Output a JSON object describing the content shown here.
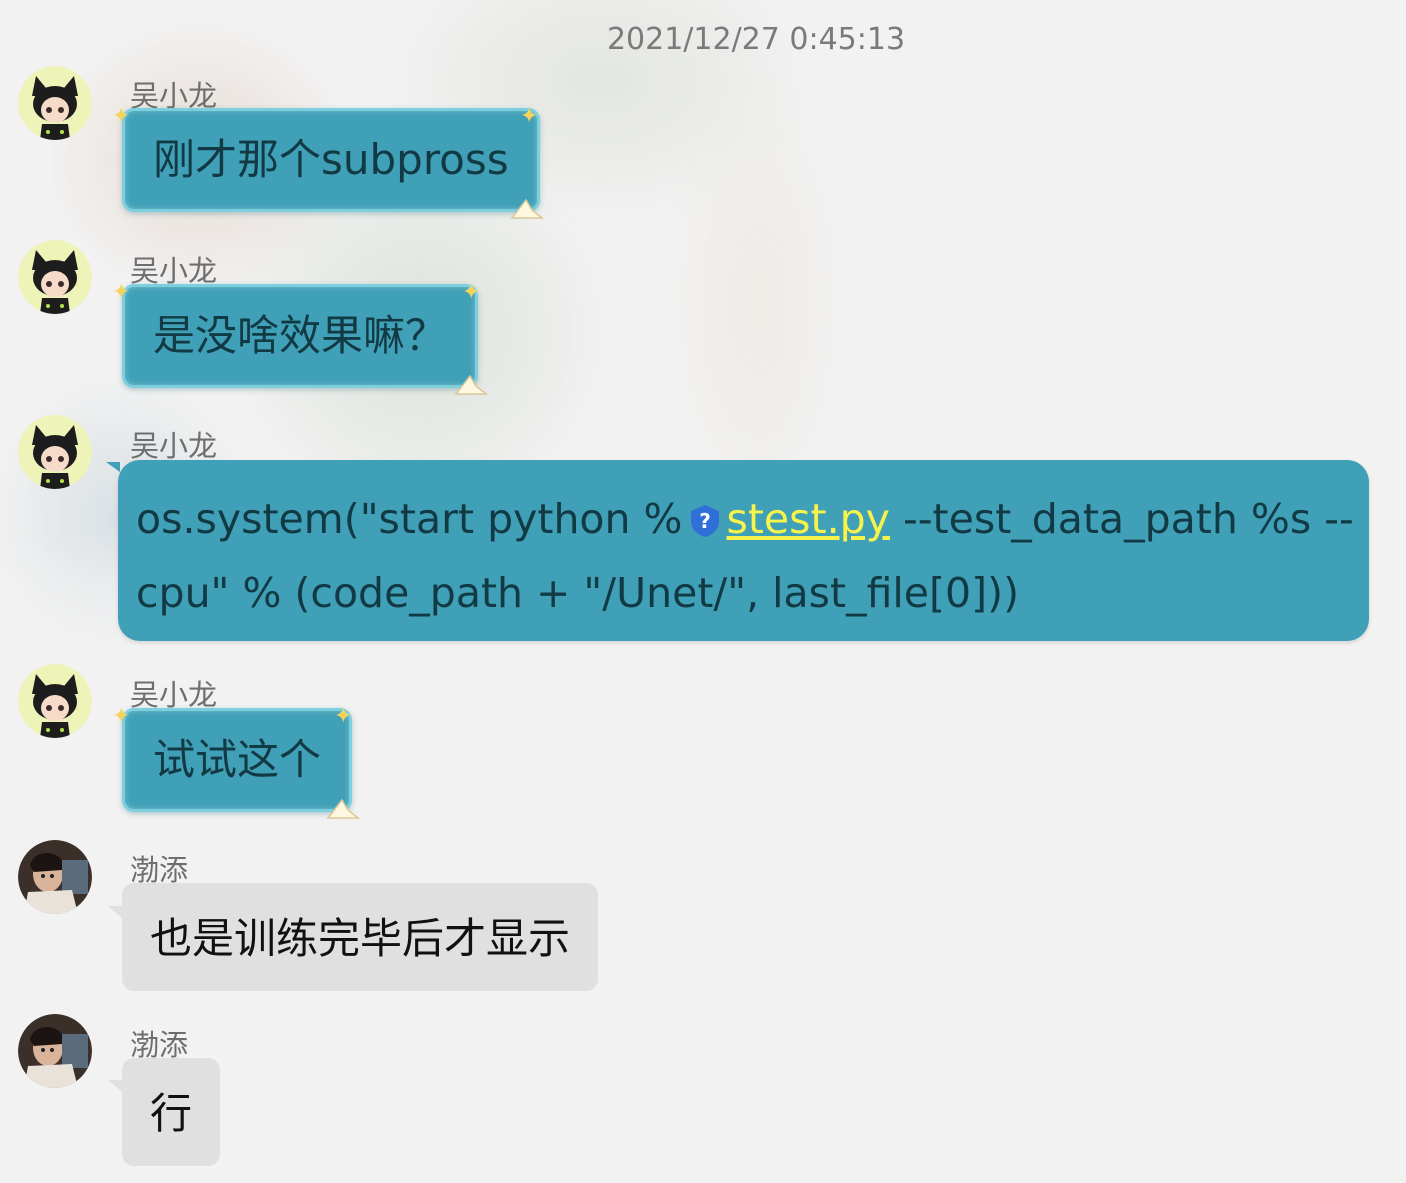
{
  "timestamp": "2021/12/27 0:45:13",
  "colors": {
    "teal_bubble": "#40a0b7",
    "teal_text": "#123a44",
    "gray_bubble": "#e0e0e0",
    "link": "#f7f34a"
  },
  "messages": [
    {
      "sender": "吴小龙",
      "text": "刚才那个subpross"
    },
    {
      "sender": "吴小龙",
      "text": "是没啥效果嘛？"
    },
    {
      "sender": "吴小龙",
      "text_before": "os.system(\"start python %",
      "icon": "question-shield-icon",
      "link": "stest.py",
      "text_after_line1": " --test_data_path %s --",
      "text_line2": "cpu\" % (code_path + \"/Unet/\", last_file[0]))"
    },
    {
      "sender": "吴小龙",
      "text": "试试这个"
    },
    {
      "sender": "渤添",
      "text": "也是训练完毕后才显示"
    },
    {
      "sender": "渤添",
      "text": "行"
    }
  ]
}
